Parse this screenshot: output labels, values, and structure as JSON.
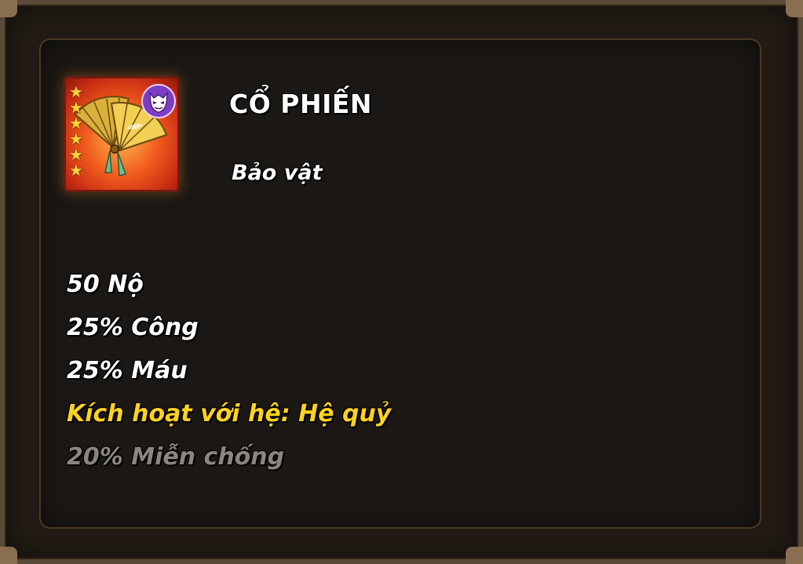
{
  "item": {
    "name": "CỔ PHIẾN",
    "type": "Bảo vật",
    "star_count": 6,
    "icon": "golden-fan-icon",
    "faction_icon": "demon-mask-icon",
    "frame_color": "#c32a12"
  },
  "stats": [
    {
      "text": "50 Nộ",
      "color": "#ffffff"
    },
    {
      "text": "25% Công",
      "color": "#ffffff"
    },
    {
      "text": "25% Máu",
      "color": "#ffffff"
    },
    {
      "text": "Kích hoạt với hệ: Hệ quỷ",
      "color": "#ffd21e"
    },
    {
      "text": "20% Miễn chống",
      "color": "#8a8580"
    }
  ],
  "colors": {
    "active_bonus": "#ffd21e",
    "inactive_bonus": "#8a8580",
    "panel_border": "#4a3824"
  }
}
